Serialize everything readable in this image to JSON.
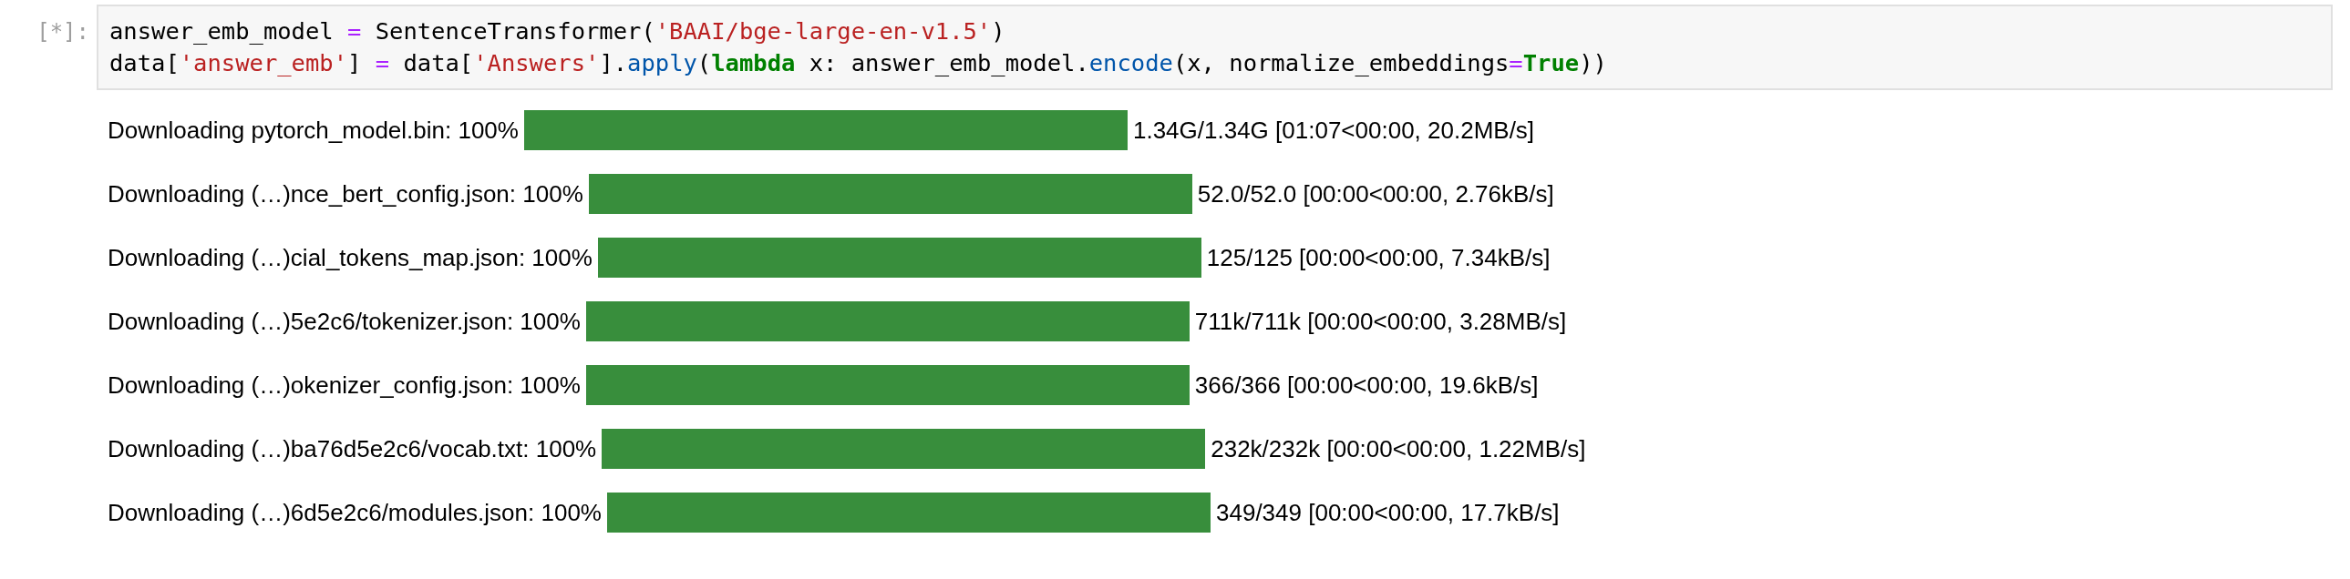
{
  "cell": {
    "prompt": "[*]:",
    "code_lines": [
      [
        {
          "kind": "name",
          "text": "answer_emb_model "
        },
        {
          "kind": "operator",
          "text": "="
        },
        {
          "kind": "name",
          "text": " SentenceTransformer("
        },
        {
          "kind": "string",
          "text": "'BAAI/bge-large-en-v1.5'"
        },
        {
          "kind": "name",
          "text": ")"
        }
      ],
      [
        {
          "kind": "name",
          "text": "data["
        },
        {
          "kind": "string",
          "text": "'answer_emb'"
        },
        {
          "kind": "name",
          "text": "] "
        },
        {
          "kind": "operator",
          "text": "="
        },
        {
          "kind": "name",
          "text": " data["
        },
        {
          "kind": "string",
          "text": "'Answers'"
        },
        {
          "kind": "name",
          "text": "]."
        },
        {
          "kind": "attribute",
          "text": "apply"
        },
        {
          "kind": "name",
          "text": "("
        },
        {
          "kind": "keyword",
          "text": "lambda"
        },
        {
          "kind": "name",
          "text": " x: answer_emb_model."
        },
        {
          "kind": "attribute",
          "text": "encode"
        },
        {
          "kind": "name",
          "text": "(x, normalize_embeddings"
        },
        {
          "kind": "operator",
          "text": "="
        },
        {
          "kind": "keyword",
          "text": "True"
        },
        {
          "kind": "name",
          "text": "))"
        }
      ]
    ]
  },
  "progress_bars": [
    {
      "label": "Downloading pytorch_model.bin: 100%",
      "level": 1,
      "reading": "1.34G/1.34G [01:07<00:00, 20.2MB/s]"
    },
    {
      "label": "Downloading (…)nce_bert_config.json: 100%",
      "level": 1,
      "reading": "52.0/52.0 [00:00<00:00, 2.76kB/s]"
    },
    {
      "label": "Downloading (…)cial_tokens_map.json: 100%",
      "level": 1,
      "reading": "125/125 [00:00<00:00, 7.34kB/s]"
    },
    {
      "label": "Downloading (…)5e2c6/tokenizer.json: 100%",
      "level": 1,
      "reading": "711k/711k [00:00<00:00, 3.28MB/s]"
    },
    {
      "label": "Downloading (…)okenizer_config.json: 100%",
      "level": 1,
      "reading": "366/366 [00:00<00:00, 19.6kB/s]"
    },
    {
      "label": "Downloading (…)ba76d5e2c6/vocab.txt: 100%",
      "level": 1,
      "reading": "232k/232k [00:00<00:00, 1.22MB/s]"
    },
    {
      "label": "Downloading (…)6d5e2c6/modules.json: 100%",
      "level": 1,
      "reading": "349/349 [00:00<00:00, 17.7kB/s]"
    }
  ]
}
